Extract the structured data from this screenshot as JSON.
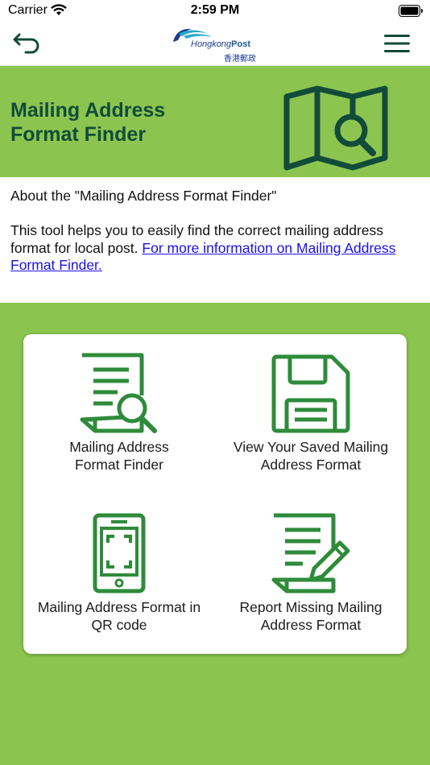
{
  "status_bar": {
    "carrier": "Carrier",
    "time": "2:59 PM"
  },
  "nav": {
    "back_icon": "back-arrow-icon",
    "menu_icon": "hamburger-menu-icon",
    "logo": {
      "english": "Hongkong",
      "english_bold": "Post",
      "chinese": "香港郵政"
    }
  },
  "hero": {
    "title_line1": "Mailing Address",
    "title_line2": "Format Finder",
    "icon": "map-search-icon"
  },
  "about": {
    "heading": "About the \"Mailing Address Format Finder\"",
    "body": "This tool helps you to easily find the correct mailing address format for local post. ",
    "link": "For more information on Mailing Address Format Finder."
  },
  "tiles": [
    {
      "line1": "Mailing Address",
      "line2": "Format Finder",
      "icon": "document-search-icon"
    },
    {
      "line1": "View Your Saved Mailing",
      "line2": "Address Format",
      "icon": "save-disk-icon"
    },
    {
      "line1": "Mailing Address Format in",
      "line2": "QR code",
      "icon": "phone-scan-icon"
    },
    {
      "line1": "Report Missing Mailing",
      "line2": "Address Format",
      "icon": "document-edit-icon"
    }
  ],
  "colors": {
    "accent_green": "#8bc54f",
    "icon_green": "#2e8b3a",
    "title_green": "#134b3a",
    "link_blue": "#1a10e8"
  }
}
